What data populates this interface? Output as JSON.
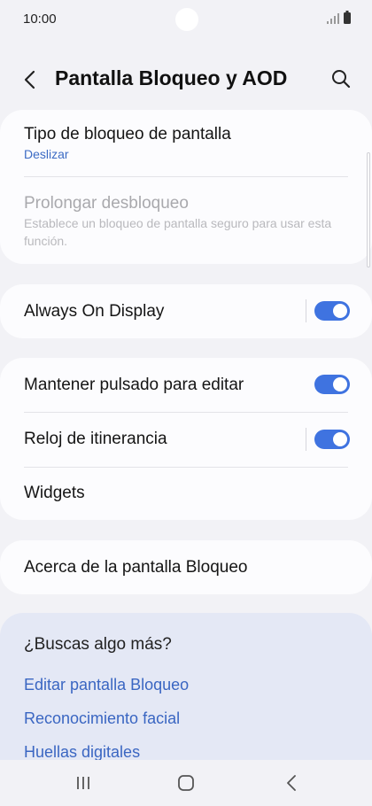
{
  "status_bar": {
    "time": "10:00"
  },
  "header": {
    "title": "Pantalla Bloqueo y AOD"
  },
  "lock_section": {
    "screen_lock_type": {
      "title": "Tipo de bloqueo de pantalla",
      "value": "Deslizar"
    },
    "extend_unlock": {
      "title": "Prolongar desbloqueo",
      "description": "Establece un bloqueo de pantalla seguro para usar esta función."
    }
  },
  "aod_section": {
    "always_on_display": {
      "title": "Always On Display",
      "enabled": true
    }
  },
  "options_section": {
    "hold_to_edit": {
      "title": "Mantener pulsado para editar",
      "enabled": true
    },
    "roaming_clock": {
      "title": "Reloj de itinerancia",
      "enabled": true
    },
    "widgets": {
      "title": "Widgets"
    }
  },
  "about_section": {
    "title": "Acerca de la pantalla Bloqueo"
  },
  "suggestions": {
    "title": "¿Buscas algo más?",
    "links": [
      "Editar pantalla Bloqueo",
      "Reconocimiento facial",
      "Huellas digitales"
    ]
  },
  "colors": {
    "accent": "#3f73e0",
    "link": "#3a66c2",
    "background": "#f2f2f6"
  }
}
